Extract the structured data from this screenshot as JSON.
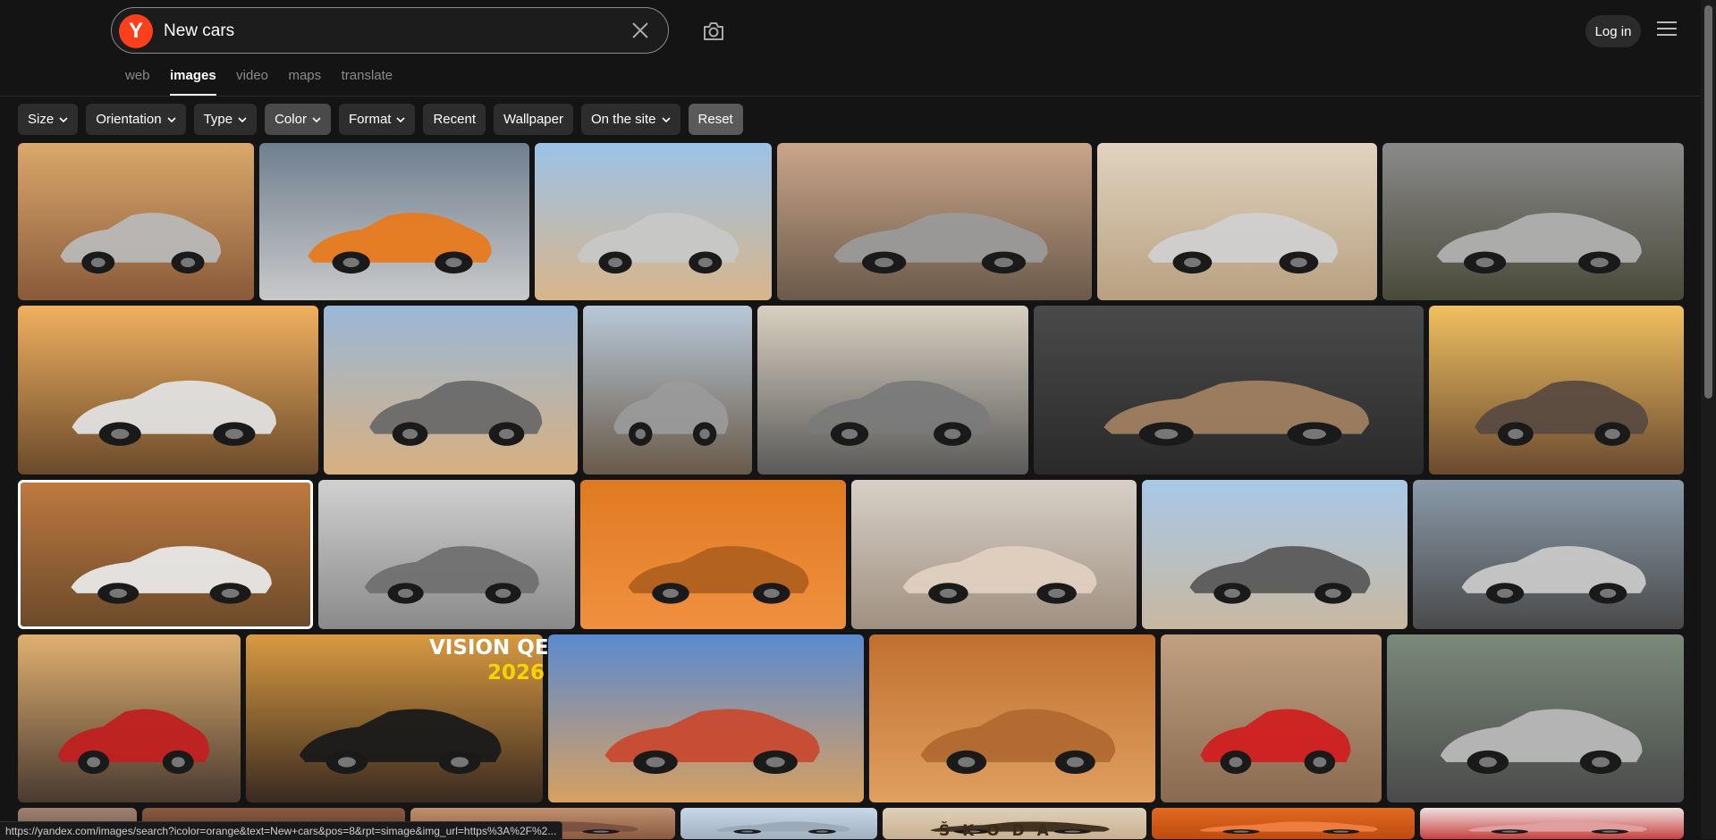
{
  "search": {
    "query": "New cars",
    "logo_letter": "Y"
  },
  "header": {
    "login_label": "Log in"
  },
  "tabs": [
    {
      "label": "web",
      "active": false
    },
    {
      "label": "images",
      "active": true
    },
    {
      "label": "video",
      "active": false
    },
    {
      "label": "maps",
      "active": false
    },
    {
      "label": "translate",
      "active": false
    }
  ],
  "filters": [
    {
      "label": "Size",
      "dropdown": true
    },
    {
      "label": "Orientation",
      "dropdown": true
    },
    {
      "label": "Type",
      "dropdown": true
    },
    {
      "label": "Color",
      "dropdown": true,
      "selected": true
    },
    {
      "label": "Format",
      "dropdown": true
    },
    {
      "label": "Recent",
      "dropdown": false
    },
    {
      "label": "Wallpaper",
      "dropdown": false
    },
    {
      "label": "On the site",
      "dropdown": true
    },
    {
      "label": "Reset",
      "dropdown": false
    }
  ],
  "overlays": {
    "vision_qe_line1": "VISION QE",
    "vision_qe_line2": "2026",
    "skoda_text": "Š K O D A"
  },
  "status_url": "https://yandex.com/images/search?icolor=orange&text=New+cars&pos=8&rpt=simage&img_url=https%3A%2F%2...",
  "colors": {
    "background": "#141414",
    "logo": "#fc3f1d",
    "chip": "#2d2d2d"
  }
}
